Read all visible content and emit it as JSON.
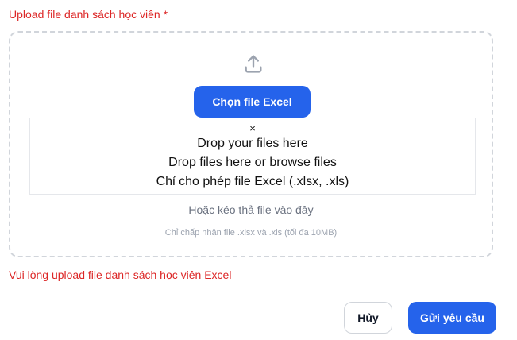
{
  "upload_field": {
    "label": "Upload file danh sách học viên *",
    "upload_icon": "upload-icon",
    "choose_button_label": "Chọn file Excel",
    "drop_overlay": {
      "close_symbol": "×",
      "title": "Drop your files here",
      "subtitle": "Drop files here or browse files",
      "restriction": "Chỉ cho phép file Excel (.xlsx, .xls)"
    },
    "drag_hint": "Hoặc kéo thả file vào đây",
    "accept_hint": "Chỉ chấp nhận file .xlsx và .xls (tối đa 10MB)",
    "error_message": "Vui lòng upload file danh sách học viên Excel"
  },
  "actions": {
    "cancel_label": "Hủy",
    "submit_label": "Gửi yêu cầu"
  },
  "colors": {
    "primary": "#2563eb",
    "error": "#dc2626",
    "border": "#d1d5db",
    "muted_text": "#6b7280"
  }
}
